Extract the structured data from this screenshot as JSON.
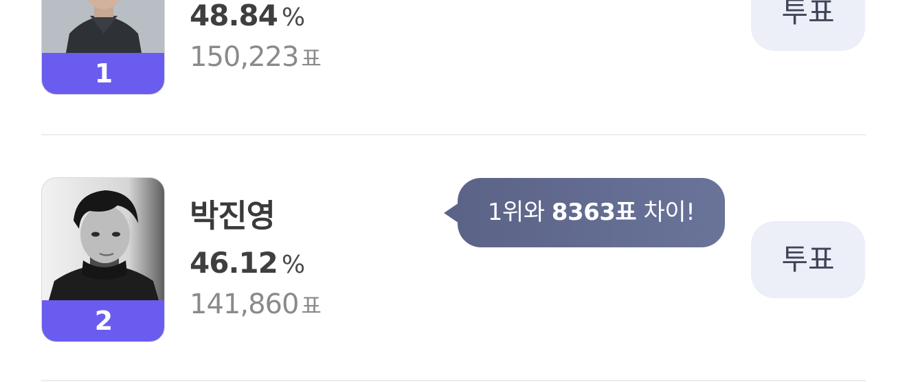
{
  "ranking": {
    "vote_unit": "표",
    "percent_unit": "%",
    "button_label": "투표",
    "entries": [
      {
        "rank": "1",
        "name": "",
        "percent": "48.84",
        "votes": "150,223"
      },
      {
        "rank": "2",
        "name": "박진영",
        "percent": "46.12",
        "votes": "141,860"
      }
    ]
  },
  "gap_tooltip": {
    "prefix": "1위와 ",
    "amount": "8363표",
    "suffix": " 차이!"
  },
  "colors": {
    "rank_badge": "#6b5cf0",
    "vote_button_bg": "#eceef8",
    "tooltip_bg": "#5f6890",
    "divider": "#ececee"
  }
}
